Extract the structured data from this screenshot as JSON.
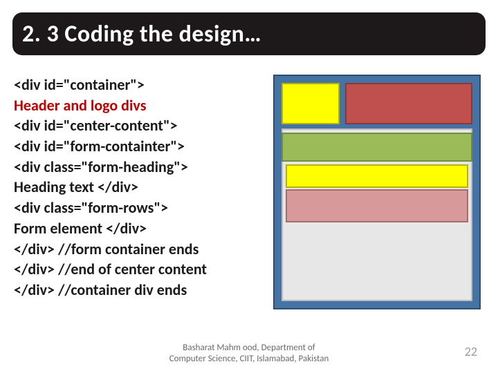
{
  "title": "2. 3 Coding the design…",
  "code": {
    "l1": "<div id=\"container\">",
    "l2": "Header and logo divs",
    "l3": "<div id=\"center-content\">",
    "l4": "<div id=\"form-containter\">",
    "l5": "<div class=\"form-heading\">",
    "l6": "Heading text </div>",
    "l7": "<div class=\"form-rows\">",
    "l8": "Form element </div>",
    "l9": "</div> //form container ends",
    "l10": "</div> //end of center content",
    "l11": "</div>  //container div ends"
  },
  "footer": {
    "line1": "Basharat Mahm ood, Department of",
    "line2": "Computer Science, CIIT, Islamabad, Pakistan"
  },
  "page_number": "22"
}
